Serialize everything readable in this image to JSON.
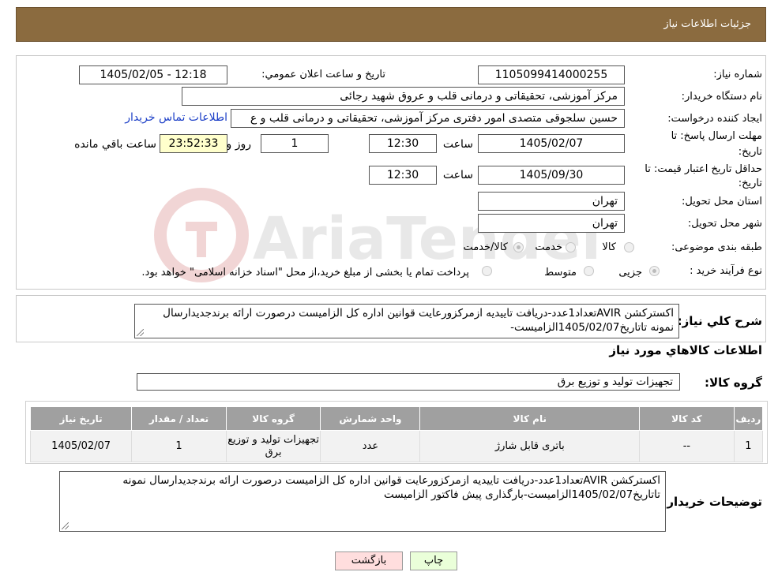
{
  "header": {
    "title": "جزئیات اطلاعات نیاز"
  },
  "form": {
    "need_number_label": "شماره نیاز:",
    "need_number": "1105099414000255",
    "announce_label": "تاريخ و ساعت اعلان عمومي:",
    "announce_value": "1405/02/05 - 12:18",
    "buyer_org_label": "نام دستگاه خریدار:",
    "buyer_org": "مرکز آموزشی، تحقیقاتی و درمانی قلب و عروق شهید رجائی",
    "creator_label": "ایجاد کننده درخواست:",
    "creator": "حسین سلجوقی متصدی امور دفتری مرکز آموزشی، تحقیقاتی و درمانی قلب و ع",
    "contact_link": "اطلاعات تماس خریدار",
    "deadline_label_1": "مهلت ارسال پاسخ: تا",
    "deadline_label_2": "تاریخ:",
    "deadline_date": "1405/02/07",
    "time_label": "ساعت",
    "deadline_time": "12:30",
    "days_value": "1",
    "days_label": "روز و",
    "remaining_time": "23:52:33",
    "remaining_label": "ساعت باقي مانده",
    "validity_label_1": "حداقل تاریخ اعتبار قیمت: تا",
    "validity_label_2": "تاریخ:",
    "validity_date": "1405/09/30",
    "validity_time_label": "ساعت",
    "validity_time": "12:30",
    "province_label": "استان محل تحویل:",
    "province": "تهران",
    "city_label": "شهر محل تحویل:",
    "city": "تهران",
    "category_label": "طبقه بندی موضوعی:",
    "category_options": [
      "کالا",
      "خدمت",
      "کالا/خدمت"
    ],
    "process_label": "نوع فرآیند خرید :",
    "process_options": [
      "جزیی",
      "متوسط"
    ],
    "process_note": "پرداخت تمام یا بخشی از مبلغ خرید،از محل \"اسناد خزانه اسلامی\" خواهد بود."
  },
  "summary": {
    "label": "شرح کلي نياز:",
    "text": "اکسترکشن AVIRتعداد1عدد-دریافت تاییدیه ازمرکزورعایت قوانین اداره کل الزامیست درصورت ارائه برندجدیدارسال نمونه تاتاریخ1405/02/07الزامیست-"
  },
  "goods": {
    "section_title": "اطلاعات کالاهاي مورد نياز",
    "group_label": "گروه کالا:",
    "group_value": "تجهیزات تولید و توزیع برق"
  },
  "table": {
    "headers": [
      "رديف",
      "کد کالا",
      "نام کالا",
      "واحد شمارش",
      "گروه کالا",
      "تعداد / مقدار",
      "تاريخ نياز"
    ],
    "rows": [
      [
        "1",
        "--",
        "باتری قابل شارژ",
        "عدد",
        "تجهیزات تولید و توزیع برق",
        "1",
        "1405/02/07"
      ]
    ]
  },
  "buyer_notes": {
    "label": "توضیحات خریدار:",
    "text": "اکسترکشن AVIRتعداد1عدد-دریافت تاییدیه ازمرکزورعایت قوانین اداره کل الزامیست درصورت ارائه برندجدیدارسال نمونه تاتاریخ1405/02/07الزامیست-بارگذاری پیش فاکتور الزامیست"
  },
  "buttons": {
    "print": "چاپ",
    "back": "بازگشت"
  },
  "watermark": "AriaTender.neT",
  "colors": {
    "header_bg": "#8b6b3f",
    "remaining_bg": "#ffffcc",
    "print_bg": "#eaffd9",
    "back_bg": "#ffdede",
    "table_header_bg": "#a0a0a0"
  }
}
